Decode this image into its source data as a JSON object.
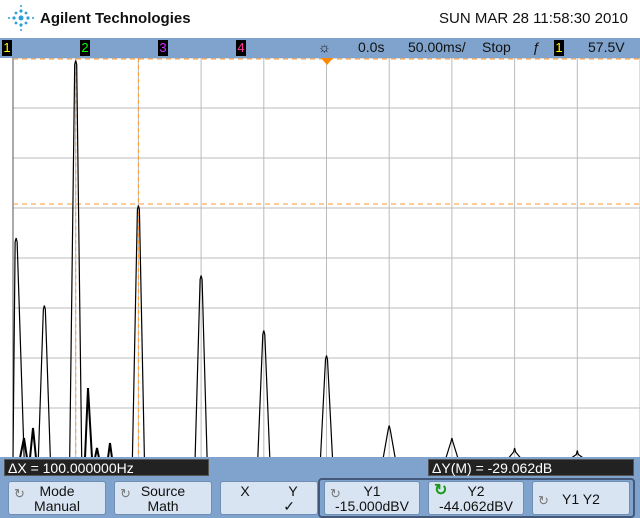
{
  "header": {
    "brand": "Agilent Technologies",
    "datetime": "SUN MAR 28 11:58:30 2010"
  },
  "status_bar": {
    "channels": [
      "1",
      "2",
      "3",
      "4"
    ],
    "channel_colors": [
      "#ffff00",
      "#00ff00",
      "#cc33ff",
      "#ff3399"
    ],
    "delay": "0.0s",
    "timebase": "50.00ms/",
    "run_state": "Stop",
    "trigger_slope_icon": "rising-edge-icon",
    "trigger_channel": "1",
    "trigger_level": "57.5V"
  },
  "readouts": {
    "delta_x": "ΔX = 100.000000Hz",
    "delta_y": "ΔY(M) = -29.062dB"
  },
  "softkeys": [
    {
      "line1": "Mode",
      "line2": "Manual"
    },
    {
      "line1": "Source",
      "line2": "Math"
    },
    {
      "line1": "X",
      "line2": "Y",
      "check": "✓"
    },
    {
      "line1": "Y1",
      "line2": "-15.000dBV"
    },
    {
      "line1": "Y2",
      "line2": "-44.062dBV"
    },
    {
      "line1": "Y1 Y2",
      "line2": ""
    }
  ],
  "trace": {
    "color": "#000000",
    "peaks_div": [
      [
        0.05,
        3.6
      ],
      [
        0.5,
        4.95
      ],
      [
        1.0,
        0.05
      ],
      [
        2.0,
        2.95
      ],
      [
        3.0,
        4.35
      ],
      [
        4.0,
        5.45
      ],
      [
        5.0,
        5.95
      ],
      [
        6.0,
        7.35
      ],
      [
        7.0,
        7.6
      ],
      [
        8.0,
        7.8
      ],
      [
        9.0,
        7.85
      ]
    ]
  },
  "cursors": {
    "color": "#ff9933",
    "x_div": [
      1.0,
      2.0
    ],
    "y_div": [
      0.0,
      2.9
    ]
  }
}
